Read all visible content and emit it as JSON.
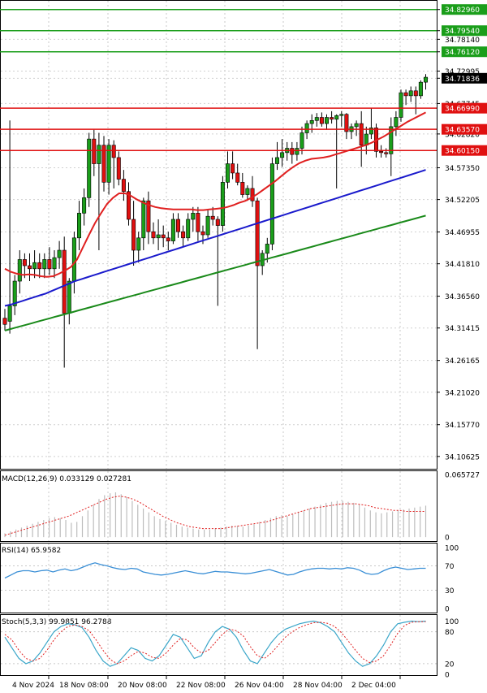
{
  "chart_data": [
    {
      "type": "candlestick",
      "panel": "price",
      "ylim": [
        34.085,
        34.845
      ],
      "y_ticks": [
        "34.82960",
        "34.79540",
        "34.78140",
        "34.76120",
        "34.72995",
        "34.71836",
        "34.67745",
        "34.62820",
        "34.57350",
        "34.52205",
        "34.46955",
        "34.41810",
        "34.36560",
        "34.31415",
        "34.26165",
        "34.21020",
        "34.15770",
        "34.10625"
      ],
      "x_labels": [
        "4 Nov 2024",
        "18 Nov 08:00",
        "20 Nov 08:00",
        "22 Nov 08:00",
        "26 Nov 04:00",
        "28 Nov 04:00",
        "2 Dec 04:00"
      ],
      "levels": [
        {
          "value": 34.8296,
          "label": "34.82960",
          "color": "#1a9e1a"
        },
        {
          "value": 34.7954,
          "label": "34.79540",
          "color": "#1a9e1a"
        },
        {
          "value": 34.7612,
          "label": "34.76120",
          "color": "#1a9e1a"
        },
        {
          "value": 34.6699,
          "label": "34.66990",
          "color": "#e01010"
        },
        {
          "value": 34.6357,
          "label": "34.63570",
          "color": "#e01010"
        },
        {
          "value": 34.6015,
          "label": "34.60150",
          "color": "#e01010"
        }
      ],
      "last_price": {
        "value": 34.71836,
        "label": "34.71836"
      },
      "candles": [
        [
          34.33,
          34.345,
          34.31,
          34.32
        ],
        [
          34.325,
          34.65,
          34.305,
          34.35
        ],
        [
          34.35,
          34.4,
          34.335,
          34.39
        ],
        [
          34.39,
          34.44,
          34.37,
          34.425
        ],
        [
          34.425,
          34.435,
          34.395,
          34.415
        ],
        [
          34.415,
          34.435,
          34.39,
          34.41
        ],
        [
          34.41,
          34.44,
          34.395,
          34.42
        ],
        [
          34.42,
          34.435,
          34.395,
          34.41
        ],
        [
          34.41,
          34.435,
          34.395,
          34.425
        ],
        [
          34.425,
          34.445,
          34.4,
          34.41
        ],
        [
          34.41,
          34.44,
          34.395,
          34.428
        ],
        [
          34.428,
          34.455,
          34.41,
          34.44
        ],
        [
          34.44,
          34.462,
          34.25,
          34.338
        ],
        [
          34.338,
          34.395,
          34.32,
          34.39
        ],
        [
          34.39,
          34.47,
          34.37,
          34.46
        ],
        [
          34.46,
          34.52,
          34.44,
          34.5
        ],
        [
          34.5,
          34.54,
          34.48,
          34.525
        ],
        [
          34.525,
          34.63,
          34.51,
          34.62
        ],
        [
          34.62,
          34.635,
          34.56,
          34.58
        ],
        [
          34.58,
          34.63,
          34.44,
          34.61
        ],
        [
          34.61,
          34.625,
          34.535,
          34.55
        ],
        [
          34.55,
          34.62,
          34.53,
          34.61
        ],
        [
          34.61,
          34.618,
          34.54,
          34.59
        ],
        [
          34.59,
          34.6,
          34.545,
          34.555
        ],
        [
          34.555,
          34.57,
          34.52,
          34.535
        ],
        [
          34.535,
          34.55,
          34.48,
          34.49
        ],
        [
          34.49,
          34.52,
          34.415,
          34.44
        ],
        [
          34.44,
          34.47,
          34.42,
          34.46
        ],
        [
          34.46,
          34.525,
          34.44,
          34.52
        ],
        [
          34.52,
          34.535,
          34.45,
          34.47
        ],
        [
          34.47,
          34.485,
          34.45,
          34.46
        ],
        [
          34.46,
          34.49,
          34.44,
          34.465
        ],
        [
          34.465,
          34.48,
          34.445,
          34.46
        ],
        [
          34.46,
          34.47,
          34.44,
          34.455
        ],
        [
          34.455,
          34.5,
          34.45,
          34.49
        ],
        [
          34.49,
          34.5,
          34.46,
          34.47
        ],
        [
          34.47,
          34.48,
          34.445,
          34.46
        ],
        [
          34.46,
          34.5,
          34.455,
          34.49
        ],
        [
          34.49,
          34.51,
          34.47,
          34.5
        ],
        [
          34.5,
          34.51,
          34.455,
          34.47
        ],
        [
          34.47,
          34.48,
          34.45,
          34.465
        ],
        [
          34.465,
          34.505,
          34.46,
          34.495
        ],
        [
          34.495,
          34.51,
          34.48,
          34.49
        ],
        [
          34.49,
          34.495,
          34.35,
          34.48
        ],
        [
          34.48,
          34.56,
          34.47,
          34.55
        ],
        [
          34.55,
          34.6,
          34.54,
          34.58
        ],
        [
          34.58,
          34.6,
          34.555,
          34.565
        ],
        [
          34.565,
          34.58,
          34.545,
          34.55
        ],
        [
          34.55,
          34.565,
          34.525,
          34.53
        ],
        [
          34.53,
          34.545,
          34.52,
          34.54
        ],
        [
          34.54,
          34.56,
          34.51,
          34.52
        ],
        [
          34.52,
          34.525,
          34.28,
          34.415
        ],
        [
          34.415,
          34.44,
          34.4,
          34.435
        ],
        [
          34.435,
          34.46,
          34.42,
          34.45
        ],
        [
          34.45,
          34.59,
          34.44,
          34.58
        ],
        [
          34.58,
          34.615,
          34.57,
          34.59
        ],
        [
          34.59,
          34.62,
          34.575,
          34.598
        ],
        [
          34.598,
          34.615,
          34.585,
          34.605
        ],
        [
          34.605,
          34.615,
          34.58,
          34.595
        ],
        [
          34.595,
          34.615,
          34.585,
          34.605
        ],
        [
          34.605,
          34.64,
          34.595,
          34.63
        ],
        [
          34.63,
          34.65,
          34.62,
          34.645
        ],
        [
          34.645,
          34.66,
          34.63,
          34.65
        ],
        [
          34.65,
          34.662,
          34.64,
          34.655
        ],
        [
          34.655,
          34.663,
          34.64,
          34.645
        ],
        [
          34.645,
          34.66,
          34.635,
          34.655
        ],
        [
          34.655,
          34.665,
          34.645,
          34.652
        ],
        [
          34.652,
          34.66,
          34.54,
          34.658
        ],
        [
          34.658,
          34.665,
          34.64,
          34.66
        ],
        [
          34.66,
          34.662,
          34.62,
          34.632
        ],
        [
          34.632,
          34.645,
          34.62,
          34.64
        ],
        [
          34.64,
          34.65,
          34.625,
          34.645
        ],
        [
          34.645,
          34.665,
          34.575,
          34.61
        ],
        [
          34.61,
          34.64,
          34.595,
          34.628
        ],
        [
          34.628,
          34.67,
          34.62,
          34.638
        ],
        [
          34.638,
          34.645,
          34.59,
          34.6
        ],
        [
          34.6,
          34.61,
          34.59,
          34.598
        ],
        [
          34.598,
          34.605,
          34.59,
          34.596
        ],
        [
          34.596,
          34.655,
          34.56,
          34.64
        ],
        [
          34.64,
          34.665,
          34.625,
          34.655
        ],
        [
          34.655,
          34.7,
          34.648,
          34.695
        ],
        [
          34.695,
          34.7,
          34.675,
          34.69
        ],
        [
          34.69,
          34.705,
          34.68,
          34.698
        ],
        [
          34.698,
          34.705,
          34.66,
          34.69
        ],
        [
          34.69,
          34.715,
          34.685,
          34.712
        ],
        [
          34.712,
          34.725,
          34.7,
          34.72
        ]
      ],
      "ma_fast": [
        34.41,
        34.405,
        34.402,
        34.4,
        34.401,
        34.4,
        34.398,
        34.397,
        34.398,
        34.402,
        34.407,
        34.413,
        34.425,
        34.445,
        34.465,
        34.484,
        34.5,
        34.515,
        34.525,
        34.532,
        34.532,
        34.528,
        34.522,
        34.517,
        34.513,
        34.51,
        34.508,
        34.507,
        34.506,
        34.506,
        34.506,
        34.506,
        34.505,
        34.505,
        34.506,
        34.507,
        34.508,
        34.51,
        34.513,
        34.517,
        34.52,
        34.525,
        34.531,
        34.538,
        34.545,
        34.552,
        34.56,
        34.568,
        34.575,
        34.581,
        34.585,
        34.588,
        34.589,
        34.59,
        34.592,
        34.595,
        34.598,
        34.601,
        34.604,
        34.607,
        34.61,
        34.614,
        34.619,
        34.624,
        34.63,
        34.636,
        34.642,
        34.648,
        34.653,
        34.658,
        34.663
      ],
      "ma_mid": [
        34.35,
        34.352,
        34.355,
        34.358,
        34.361,
        34.364,
        34.367,
        34.37,
        34.374,
        34.378,
        34.382,
        34.386,
        34.39,
        34.393,
        34.396,
        34.399,
        34.402,
        34.405,
        34.408,
        34.411,
        34.414,
        34.417,
        34.42,
        34.423,
        34.426,
        34.429,
        34.432,
        34.435,
        34.438,
        34.441,
        34.444,
        34.447,
        34.45,
        34.453,
        34.456,
        34.459,
        34.462,
        34.465,
        34.468,
        34.471,
        34.474,
        34.477,
        34.48,
        34.483,
        34.486,
        34.489,
        34.492,
        34.495,
        34.498,
        34.501,
        34.504,
        34.507,
        34.51,
        34.513,
        34.516,
        34.519,
        34.522,
        34.525,
        34.528,
        34.531,
        34.534,
        34.537,
        34.54,
        34.543,
        34.546,
        34.549,
        34.552,
        34.555,
        34.558,
        34.561,
        34.564,
        34.567,
        34.57
      ],
      "ma_slow": [
        34.31,
        34.312,
        34.314,
        34.316,
        34.318,
        34.32,
        34.322,
        34.324,
        34.326,
        34.328,
        34.33,
        34.332,
        34.334,
        34.336,
        34.338,
        34.34,
        34.342,
        34.344,
        34.346,
        34.348,
        34.35,
        34.352,
        34.354,
        34.356,
        34.358,
        34.36,
        34.362,
        34.364,
        34.366,
        34.368,
        34.37,
        34.372,
        34.374,
        34.376,
        34.378,
        34.38,
        34.382,
        34.384,
        34.386,
        34.388,
        34.39,
        34.392,
        34.394,
        34.396,
        34.398,
        34.4,
        34.402,
        34.404,
        34.406,
        34.408,
        34.41,
        34.412,
        34.414,
        34.416,
        34.418,
        34.42,
        34.422,
        34.424,
        34.426,
        34.428,
        34.43,
        34.432,
        34.434,
        34.436,
        34.438,
        34.44,
        34.442,
        34.444,
        34.446,
        34.448,
        34.45,
        34.452,
        34.454,
        34.456,
        34.458,
        34.46,
        34.462,
        34.464,
        34.466,
        34.468,
        34.47,
        34.472,
        34.474,
        34.476,
        34.478,
        34.48,
        34.482,
        34.484,
        34.486,
        34.488,
        34.49,
        34.492,
        34.494,
        34.496
      ]
    },
    {
      "type": "bar",
      "panel": "macd",
      "title": "MACD(12,26,9) 0.033129 0.027281",
      "ylim": [
        -0.005,
        0.07
      ],
      "y_ticks": [
        "0.065727",
        "0"
      ],
      "histogram": [
        0.004,
        0.006,
        0.008,
        0.01,
        0.012,
        0.014,
        0.016,
        0.018,
        0.02,
        0.021,
        0.02,
        0.018,
        0.015,
        0.016,
        0.022,
        0.028,
        0.034,
        0.04,
        0.044,
        0.046,
        0.047,
        0.045,
        0.042,
        0.038,
        0.034,
        0.03,
        0.026,
        0.022,
        0.019,
        0.017,
        0.015,
        0.013,
        0.011,
        0.01,
        0.009,
        0.008,
        0.008,
        0.008,
        0.009,
        0.01,
        0.011,
        0.012,
        0.012,
        0.011,
        0.012,
        0.014,
        0.016,
        0.018,
        0.02,
        0.022,
        0.023,
        0.022,
        0.024,
        0.026,
        0.028,
        0.03,
        0.032,
        0.034,
        0.036,
        0.037,
        0.038,
        0.038,
        0.037,
        0.036,
        0.034,
        0.031,
        0.028,
        0.026,
        0.025,
        0.026,
        0.027,
        0.028,
        0.029,
        0.03,
        0.031,
        0.032,
        0.033
      ],
      "signal": [
        0.002,
        0.004,
        0.006,
        0.008,
        0.01,
        0.012,
        0.014,
        0.016,
        0.018,
        0.02,
        0.022,
        0.025,
        0.028,
        0.031,
        0.034,
        0.037,
        0.04,
        0.042,
        0.043,
        0.042,
        0.04,
        0.037,
        0.033,
        0.029,
        0.025,
        0.021,
        0.018,
        0.015,
        0.013,
        0.011,
        0.01,
        0.009,
        0.009,
        0.009,
        0.009,
        0.01,
        0.011,
        0.012,
        0.013,
        0.014,
        0.015,
        0.016,
        0.018,
        0.02,
        0.022,
        0.024,
        0.026,
        0.028,
        0.03,
        0.031,
        0.032,
        0.033,
        0.034,
        0.035,
        0.035,
        0.035,
        0.034,
        0.033,
        0.031,
        0.03,
        0.029,
        0.028,
        0.028,
        0.027,
        0.027,
        0.027,
        0.027
      ]
    },
    {
      "type": "line",
      "panel": "rsi",
      "title": "RSI(14) 65.9582",
      "ylim": [
        0,
        100
      ],
      "y_ticks": [
        "100",
        "70",
        "30",
        "0"
      ],
      "values": [
        50,
        55,
        60,
        62,
        62,
        60,
        62,
        63,
        60,
        63,
        65,
        62,
        64,
        68,
        72,
        75,
        72,
        70,
        67,
        65,
        64,
        66,
        65,
        60,
        58,
        56,
        55,
        56,
        58,
        60,
        62,
        60,
        58,
        57,
        59,
        61,
        60,
        60,
        59,
        58,
        57,
        58,
        60,
        62,
        64,
        61,
        58,
        55,
        56,
        60,
        63,
        65,
        66,
        66,
        65,
        66,
        65,
        67,
        66,
        63,
        58,
        56,
        57,
        62,
        66,
        68,
        66,
        64,
        65,
        66,
        66
      ]
    },
    {
      "type": "line",
      "panel": "stoch",
      "title": "Stoch(5,3,3) 99.9851 96.2788",
      "ylim": [
        0,
        110
      ],
      "y_ticks": [
        "100",
        "80",
        "20",
        "0"
      ],
      "k": [
        70,
        50,
        30,
        20,
        25,
        40,
        60,
        80,
        90,
        95,
        93,
        88,
        70,
        45,
        25,
        15,
        20,
        35,
        50,
        45,
        30,
        25,
        35,
        55,
        75,
        70,
        50,
        30,
        35,
        60,
        80,
        90,
        85,
        70,
        45,
        25,
        20,
        40,
        60,
        75,
        85,
        90,
        95,
        98,
        100,
        97,
        90,
        80,
        60,
        40,
        25,
        15,
        20,
        35,
        55,
        80,
        95,
        98,
        100,
        99,
        100
      ],
      "d": [
        75,
        65,
        45,
        30,
        25,
        30,
        45,
        65,
        80,
        90,
        93,
        90,
        82,
        65,
        45,
        28,
        20,
        25,
        35,
        43,
        40,
        32,
        30,
        40,
        55,
        67,
        65,
        50,
        40,
        45,
        60,
        75,
        85,
        82,
        72,
        52,
        35,
        30,
        40,
        55,
        70,
        80,
        88,
        93,
        97,
        98,
        96,
        90,
        78,
        62,
        45,
        30,
        22,
        25,
        35,
        55,
        77,
        92,
        98,
        99,
        99
      ]
    }
  ]
}
